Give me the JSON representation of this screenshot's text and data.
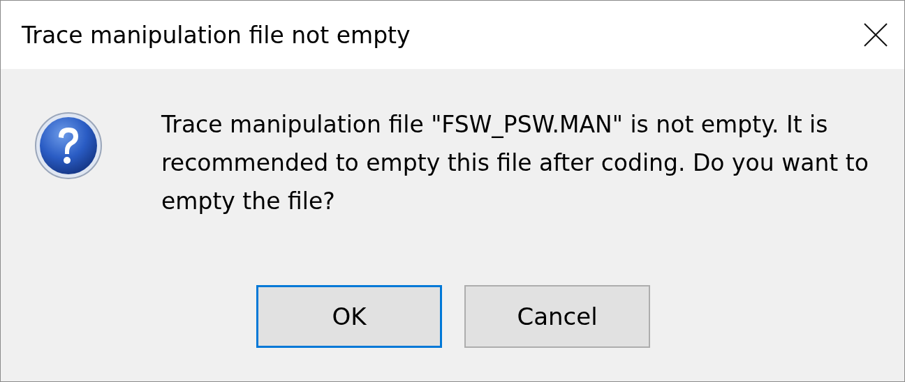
{
  "window": {
    "title": "Trace manipulation file not empty"
  },
  "dialog": {
    "message": "Trace manipulation file \"FSW_PSW.MAN\" is not empty. It is recommended to empty this file after coding. Do you want to empty the file?"
  },
  "buttons": [
    {
      "label": "OK",
      "default": true
    },
    {
      "label": "Cancel",
      "default": false
    }
  ]
}
